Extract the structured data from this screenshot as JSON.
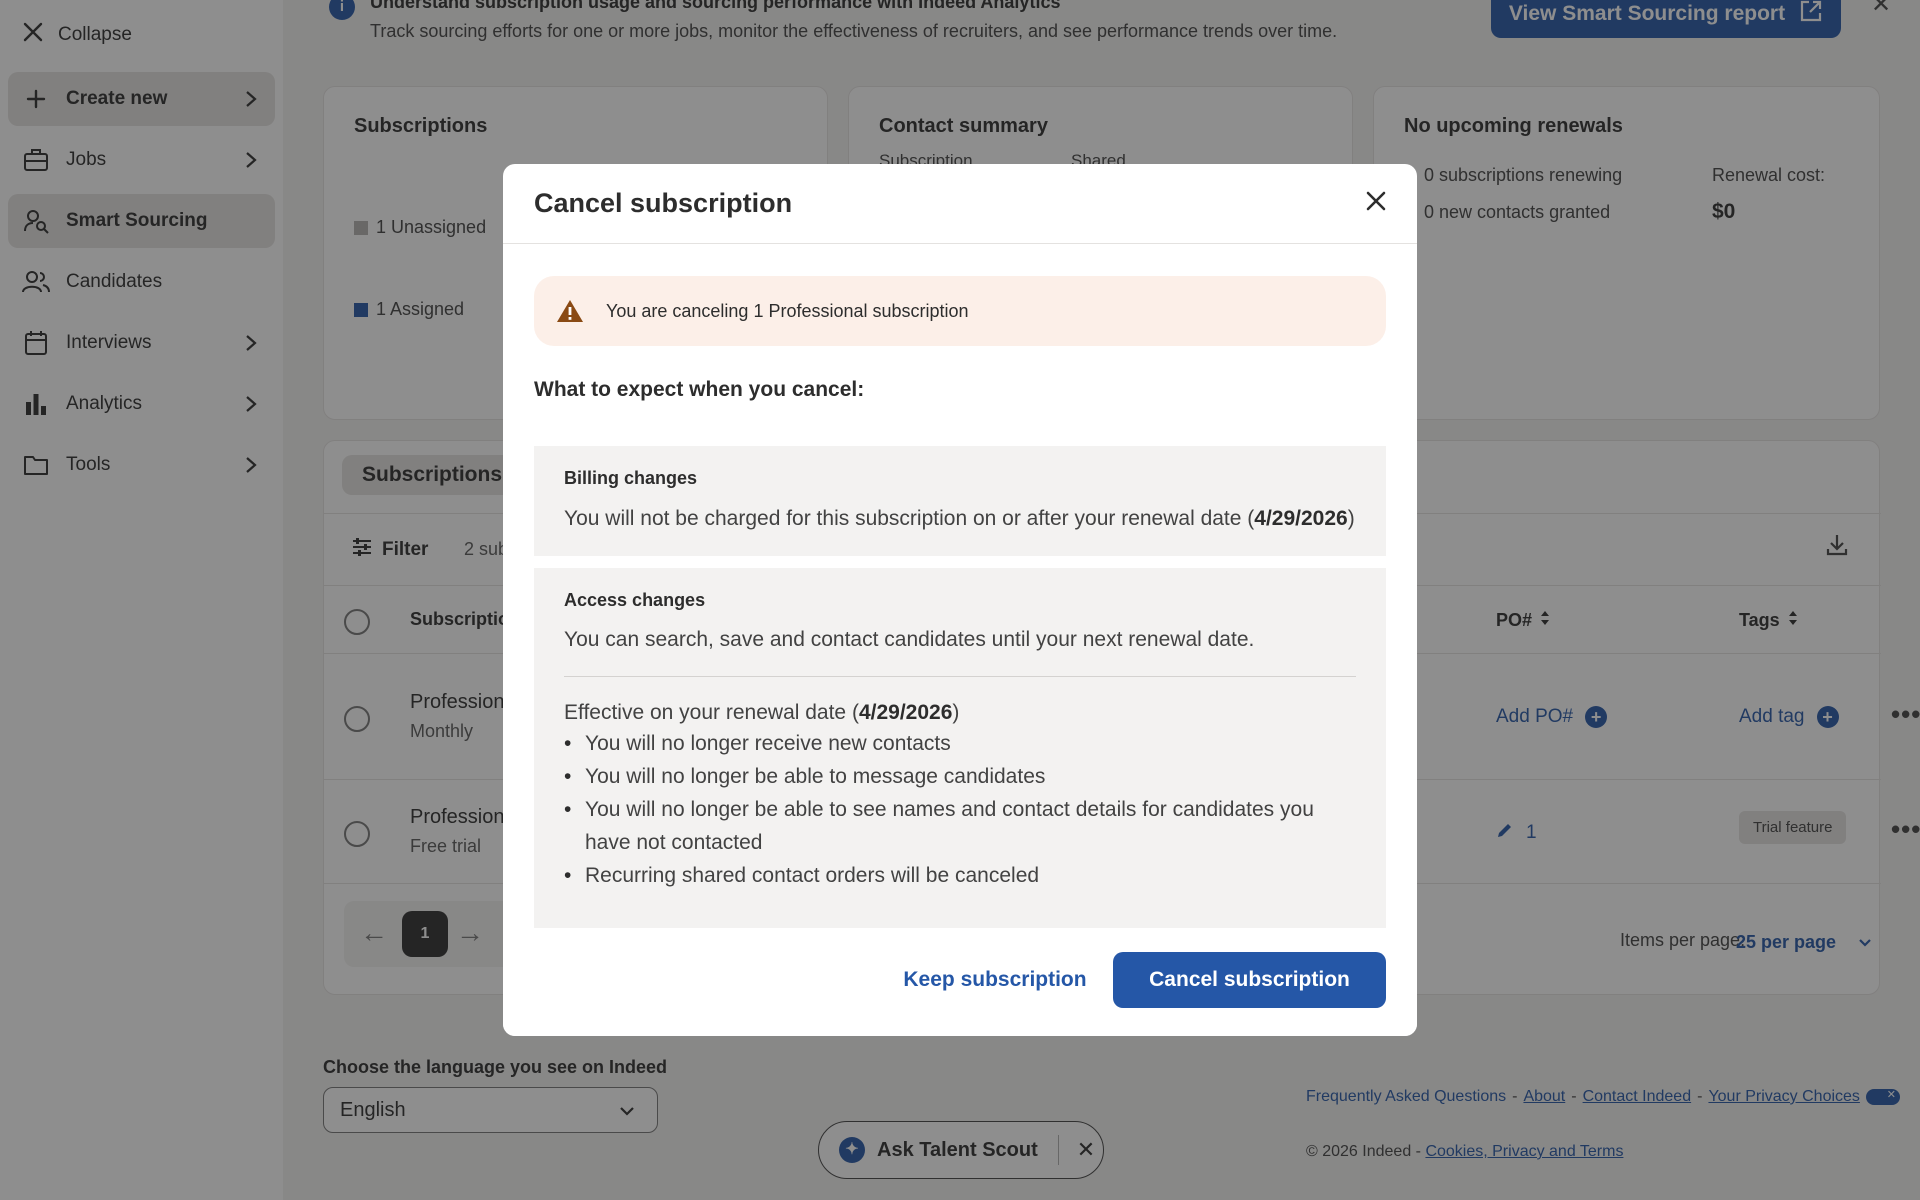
{
  "sidebar": {
    "collapse_label": "Collapse",
    "items": [
      {
        "label": "Create new",
        "icon": "plus-icon"
      },
      {
        "label": "Jobs",
        "icon": "briefcase-icon"
      },
      {
        "label": "Smart Sourcing",
        "icon": "person-search-icon"
      },
      {
        "label": "Candidates",
        "icon": "people-icon"
      },
      {
        "label": "Interviews",
        "icon": "calendar-icon"
      },
      {
        "label": "Analytics",
        "icon": "bar-chart-icon"
      },
      {
        "label": "Tools",
        "icon": "folder-icon"
      }
    ]
  },
  "banner": {
    "title": "Understand subscription usage and sourcing performance with Indeed Analytics",
    "text": "Track sourcing efforts for one or more jobs, monitor the effectiveness of recruiters, and see performance trends over time.",
    "button_label": "View Smart Sourcing report"
  },
  "cards": {
    "subscriptions": {
      "title": "Subscriptions",
      "unassigned": "1 Unassigned",
      "assigned": "1 Assigned"
    },
    "contact_summary": {
      "title": "Contact summary",
      "col1": "Subscription",
      "col2": "Shared"
    },
    "renewals": {
      "title": "No upcoming renewals",
      "renewing": "0 subscriptions renewing",
      "new_contacts": "0 new contacts granted",
      "cost_label": "Renewal cost:",
      "cost_value": "$0"
    }
  },
  "table": {
    "tab_label": "Subscriptions",
    "filter_label": "Filter",
    "count_text": "2 sub",
    "headers": {
      "subscription": "Subscriptio",
      "po": "PO#",
      "tags": "Tags"
    },
    "rows": [
      {
        "title": "Profession",
        "sub": "Monthly",
        "po": "Add PO#",
        "tags": "Add tag"
      },
      {
        "title": "Profession",
        "sub": "Free trial",
        "po": "1",
        "tags": "Trial feature"
      }
    ],
    "page": "1",
    "per_page_label": "Items per page:",
    "per_page_value": "25 per page"
  },
  "footer": {
    "lang_label": "Choose the language you see on Indeed",
    "lang_value": "English",
    "links": [
      "Frequently Asked Questions",
      "About",
      "Contact Indeed",
      "Your Privacy Choices"
    ],
    "copyright": "© 2026 Indeed -",
    "copyright_link": "Cookies, Privacy and Terms",
    "scout_label": "Ask Talent Scout"
  },
  "modal": {
    "title": "Cancel subscription",
    "warning": "You are canceling 1 Professional subscription",
    "expect_heading": "What to expect when you cancel:",
    "billing": {
      "heading": "Billing changes",
      "text_before": "You will not be charged for this subscription on or after your renewal date (",
      "date": "4/29/2026",
      "text_after": ")"
    },
    "access": {
      "heading": "Access changes",
      "text": "You can search, save and contact candidates until your next renewal date.",
      "effective_before": "Effective on your renewal date (",
      "effective_date": "4/29/2026",
      "effective_after": ")",
      "bullets": [
        "You will no longer receive new contacts",
        "You will no longer be able to message candidates",
        "You will no longer be able to see names and contact details for candidates you have not contacted",
        "Recurring shared contact orders will be canceled"
      ]
    },
    "keep_label": "Keep subscription",
    "cancel_label": "Cancel subscription"
  }
}
